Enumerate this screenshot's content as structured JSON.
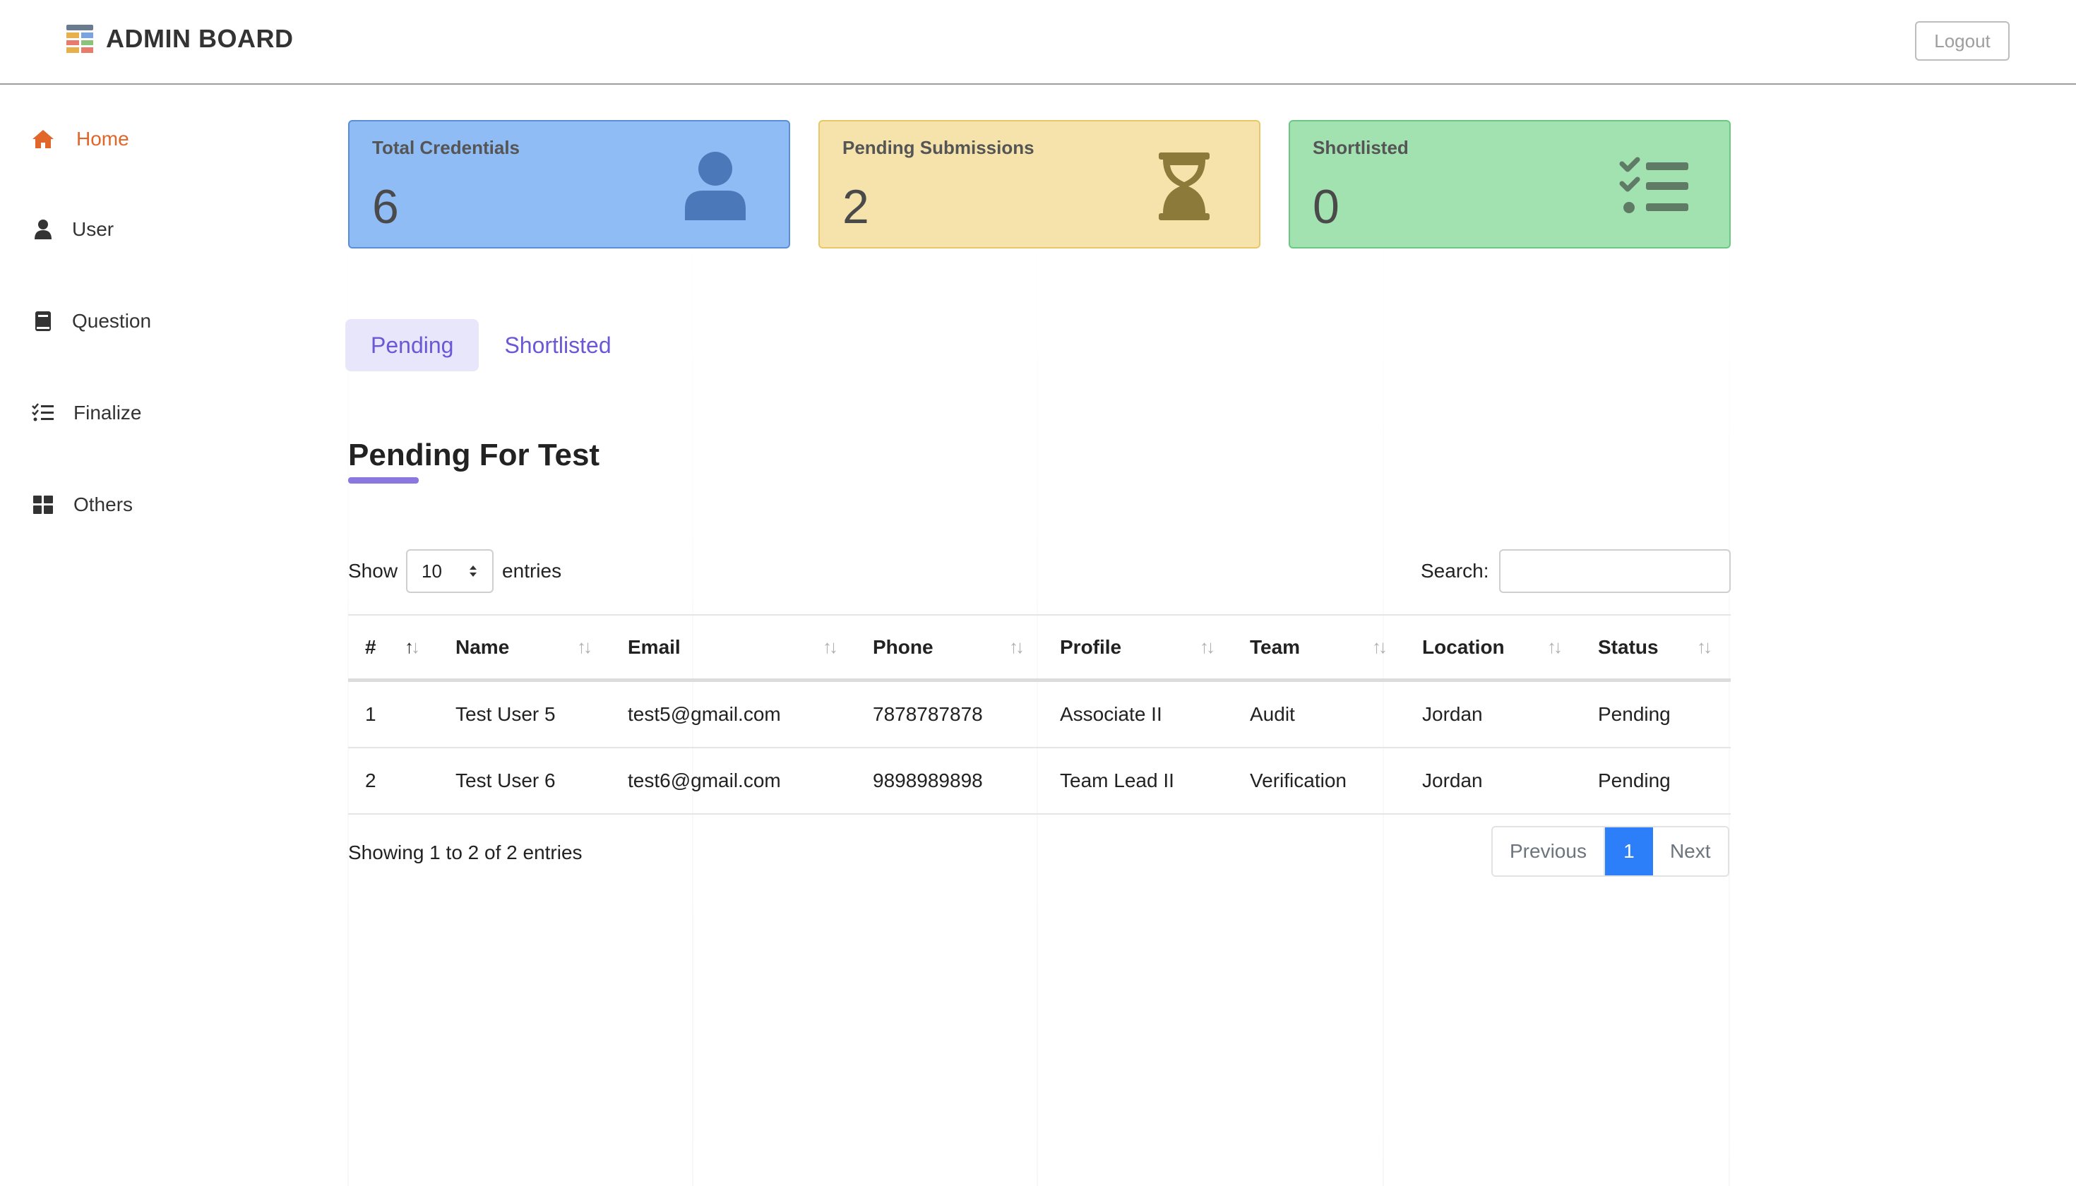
{
  "header": {
    "brand_title": "ADMIN BOARD",
    "logout_label": "Logout"
  },
  "sidebar": {
    "items": [
      {
        "label": "Home",
        "icon": "home-icon",
        "active": true
      },
      {
        "label": "User",
        "icon": "user-icon",
        "active": false
      },
      {
        "label": "Question",
        "icon": "book-icon",
        "active": false
      },
      {
        "label": "Finalize",
        "icon": "checklist-icon",
        "active": false
      },
      {
        "label": "Others",
        "icon": "grid-icon",
        "active": false
      }
    ]
  },
  "cards": [
    {
      "title": "Total Credentials",
      "value": "6",
      "icon": "user-icon",
      "color": "#90bcf5"
    },
    {
      "title": "Pending Submissions",
      "value": "2",
      "icon": "hourglass-icon",
      "color": "#f5e3ab"
    },
    {
      "title": "Shortlisted",
      "value": "0",
      "icon": "checklist-icon",
      "color": "#a2e1b0"
    }
  ],
  "tabs": [
    {
      "label": "Pending",
      "active": true
    },
    {
      "label": "Shortlisted",
      "active": false
    }
  ],
  "section": {
    "title": "Pending For Test"
  },
  "table_controls": {
    "show_label": "Show",
    "page_size": "10",
    "entries_label": "entries",
    "search_label": "Search:",
    "search_value": ""
  },
  "table": {
    "columns": [
      "#",
      "Name",
      "Email",
      "Phone",
      "Profile",
      "Team",
      "Location",
      "Status"
    ],
    "rows": [
      [
        "1",
        "Test User 5",
        "test5@gmail.com",
        "7878787878",
        "Associate II",
        "Audit",
        "Jordan",
        "Pending"
      ],
      [
        "2",
        "Test User 6",
        "test6@gmail.com",
        "9898989898",
        "Team Lead II",
        "Verification",
        "Jordan",
        "Pending"
      ]
    ]
  },
  "footer": {
    "showing_info": "Showing 1 to 2 of 2 entries",
    "prev_label": "Previous",
    "current_page": "1",
    "next_label": "Next"
  },
  "colors": {
    "accent": "#6b58d6",
    "active_nav": "#e0662a",
    "pager_active": "#2d7ff9"
  }
}
